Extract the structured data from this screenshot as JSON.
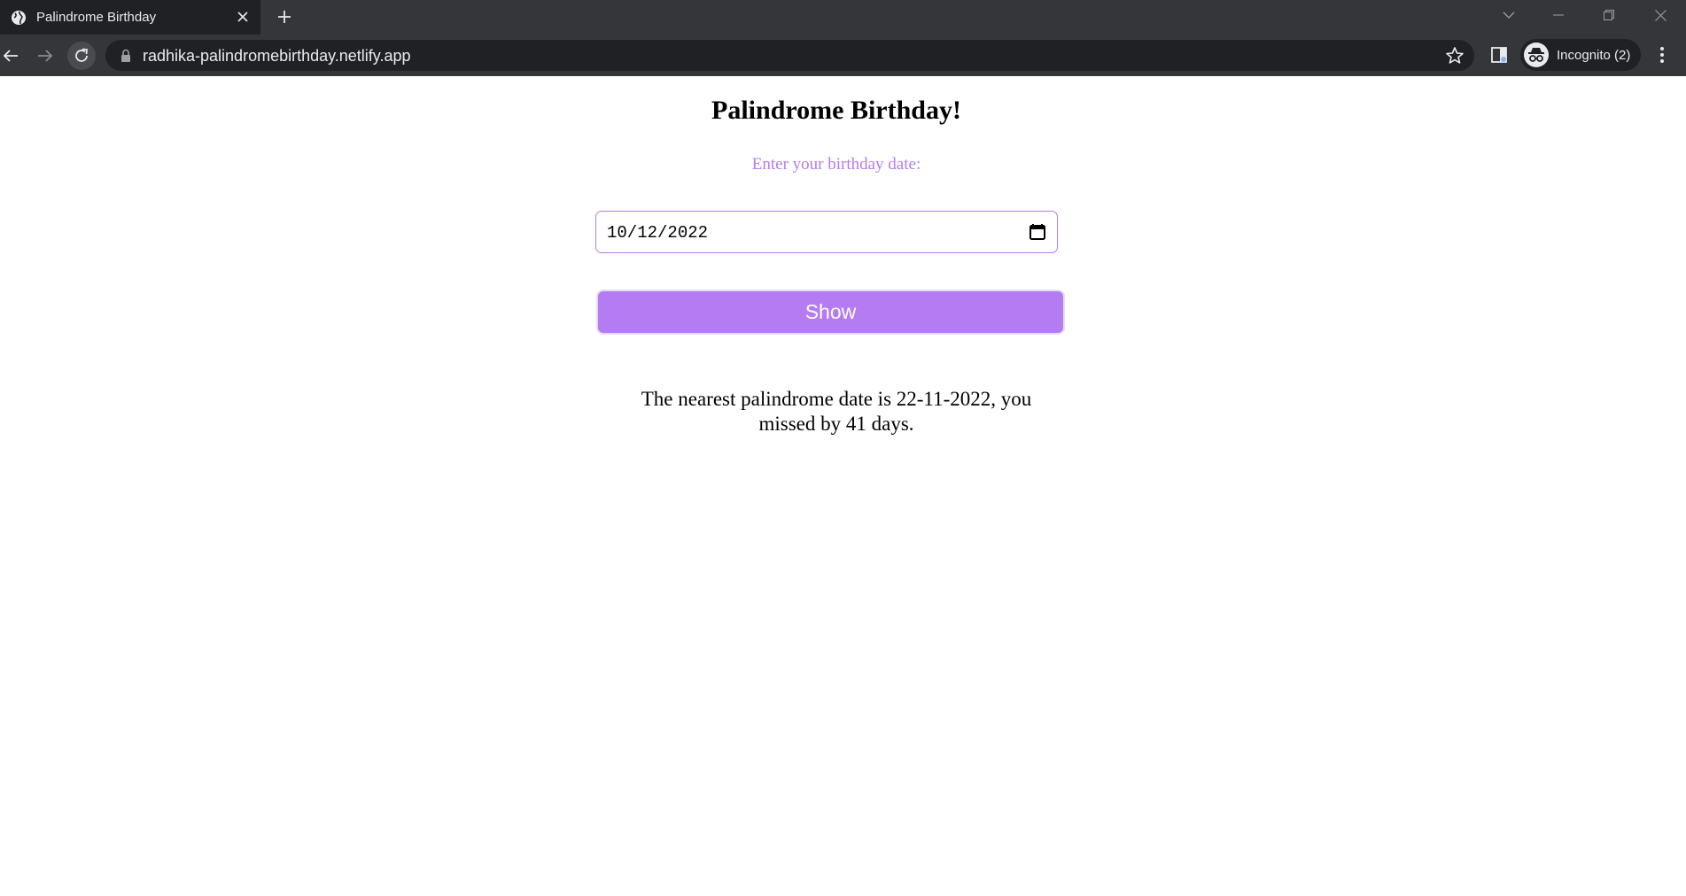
{
  "browser": {
    "tab": {
      "title": "Palindrome Birthday",
      "favicon": "globe-icon"
    },
    "address_bar": {
      "url": "radhika-palindromebirthday.netlify.app"
    },
    "profile": {
      "label": "Incognito (2)"
    },
    "colors": {
      "frame": "#35363a",
      "active_tab": "#202124",
      "text": "#e8eaed"
    }
  },
  "page": {
    "title": "Palindrome Birthday!",
    "prompt": "Enter your birthday date:",
    "date_input": {
      "value": "10/12/2022"
    },
    "show_button": {
      "label": "Show"
    },
    "result": "The nearest palindrome date is 22-11-2022, you missed by 41 days.",
    "colors": {
      "accent": "#b57bf3",
      "prompt_text": "#b57bee"
    }
  }
}
